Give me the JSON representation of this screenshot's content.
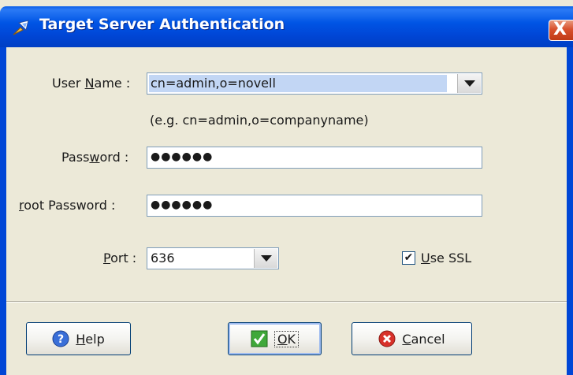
{
  "window": {
    "title": "Target Server Authentication",
    "close_label": "X"
  },
  "form": {
    "username_label_pre": "User ",
    "username_label_mnemonic": "N",
    "username_label_post": "ame :",
    "username_value": "cn=admin,o=novell",
    "username_hint": "(e.g. cn=admin,o=companyname)",
    "password_label_pre": "Pass",
    "password_label_mnemonic": "w",
    "password_label_post": "ord :",
    "password_value": "●●●●●●",
    "root_label_mnemonic": "r",
    "root_label_post": "oot Password :",
    "root_password_value": "●●●●●●",
    "port_label_mnemonic": "P",
    "port_label_post": "ort :",
    "port_value": "636",
    "ssl_checked_glyph": "✔",
    "ssl_label_mnemonic": "U",
    "ssl_label_post": "se SSL"
  },
  "buttons": {
    "help_mnemonic": "H",
    "help_post": "elp",
    "ok_mnemonic": "O",
    "ok_post": "K",
    "cancel_mnemonic": "C",
    "cancel_post": "ancel"
  },
  "colors": {
    "title_bar": "#0055e5",
    "selection": "#c2d6f4",
    "window_bg": "#ece9d8",
    "close_button": "#d8502c"
  },
  "icons": {
    "title": "arrow-pin-icon",
    "help": "help-icon",
    "ok": "checkmark-icon",
    "cancel": "cancel-icon"
  }
}
